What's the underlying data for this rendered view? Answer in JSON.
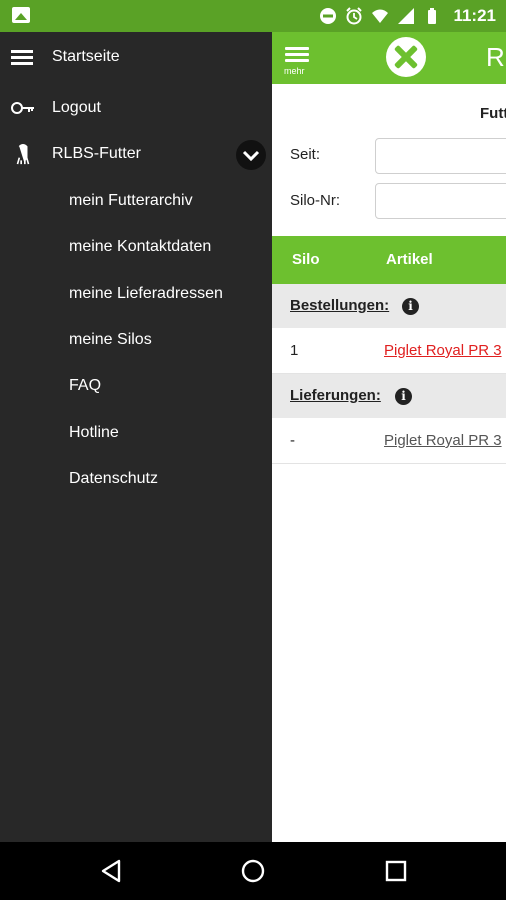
{
  "status_bar": {
    "time": "11:21",
    "icons": [
      "image-notification-icon",
      "do-not-disturb-icon",
      "alarm-icon",
      "wifi-icon",
      "signal-icon",
      "battery-icon"
    ]
  },
  "header": {
    "menu_label": "mehr",
    "title_partial": "R"
  },
  "drawer": {
    "items": [
      {
        "label": "Startseite",
        "icon": "hamburger-icon"
      },
      {
        "label": "Logout",
        "icon": "key-icon"
      },
      {
        "label": "RLBS-Futter",
        "icon": "silo-icon",
        "expanded": true
      }
    ],
    "sub_items": [
      {
        "label": "mein Futterarchiv"
      },
      {
        "label": "meine Kontaktdaten"
      },
      {
        "label": "meine Lieferadressen"
      },
      {
        "label": "meine Silos"
      },
      {
        "label": "FAQ"
      },
      {
        "label": "Hotline"
      },
      {
        "label": "Datenschutz"
      }
    ]
  },
  "filter": {
    "title": "Futt",
    "seit_label": "Seit:",
    "seit_value": "",
    "silo_label": "Silo-Nr:",
    "silo_value": ""
  },
  "table": {
    "headers": [
      "Silo",
      "Artikel"
    ],
    "sections": [
      {
        "label": "Bestellungen:",
        "rows": [
          {
            "silo": "1",
            "artikel": "Piglet Royal PR 3"
          }
        ]
      },
      {
        "label": "Lieferungen:",
        "rows": [
          {
            "silo": "-",
            "artikel": "Piglet Royal PR 3"
          }
        ]
      }
    ]
  },
  "colors": {
    "brand_green": "#6dc02f",
    "status_green": "#5aa226",
    "drawer_bg": "#282828",
    "order_link": "#e02020",
    "delivery_link": "#555555"
  }
}
